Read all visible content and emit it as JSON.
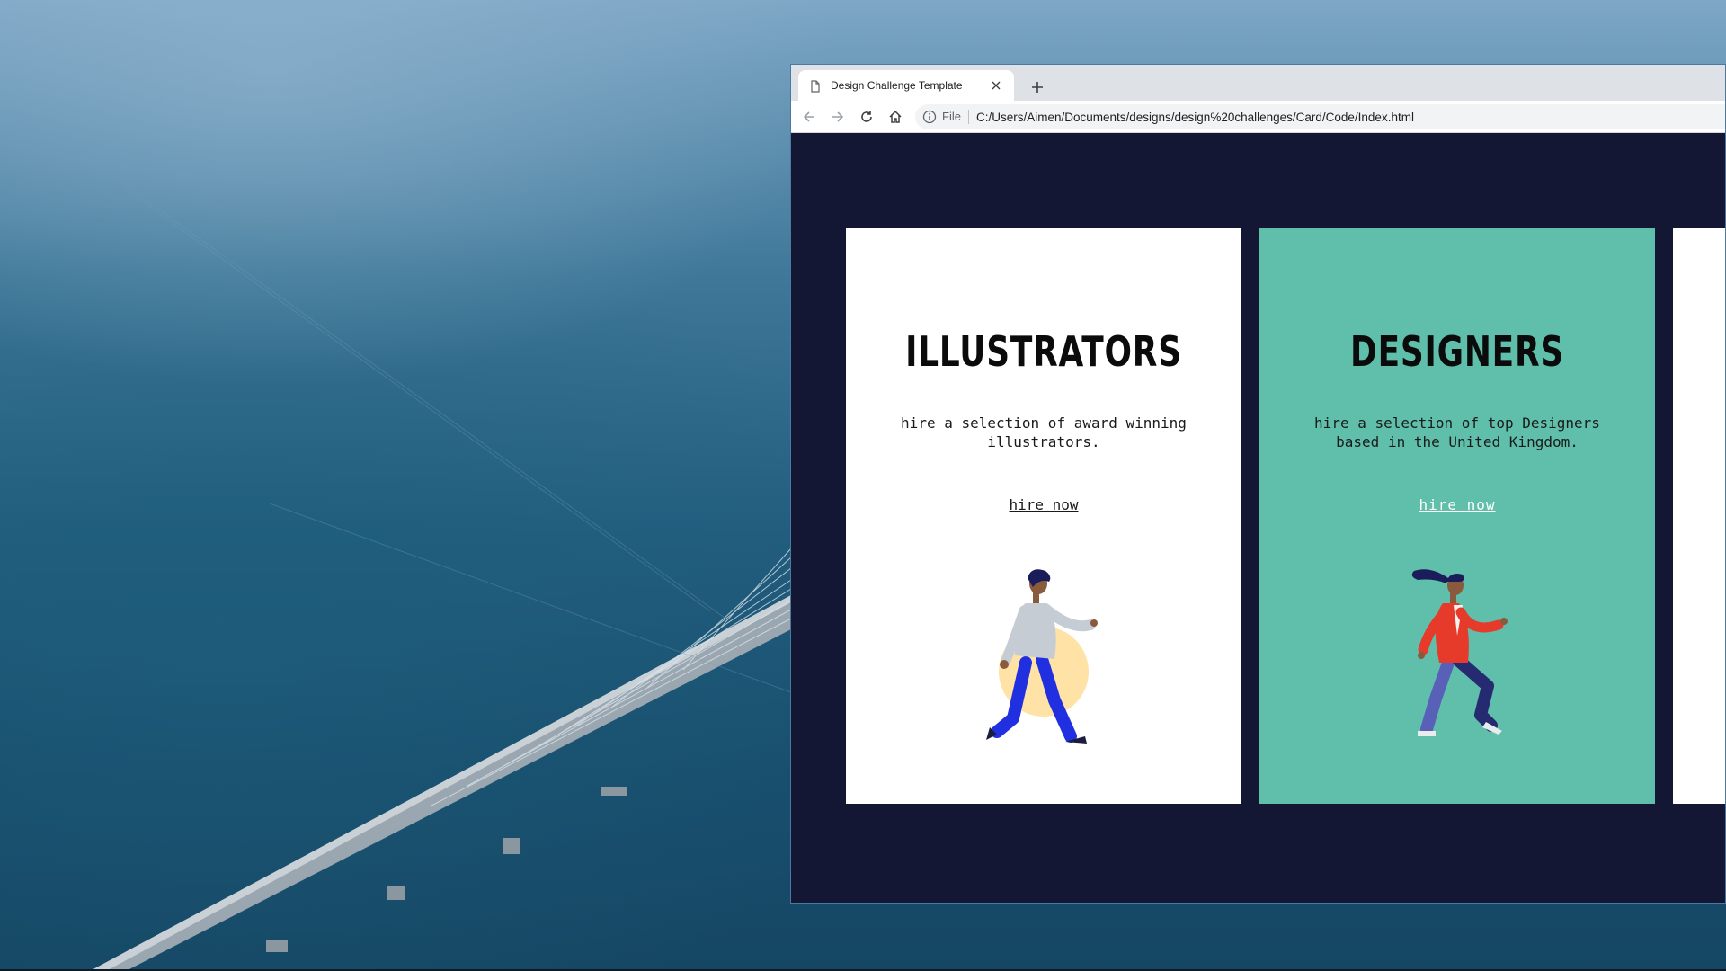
{
  "browser": {
    "tab_title": "Design Challenge Template",
    "address_scheme": "File",
    "address_url": "C:/Users/Aimen/Documents/designs/design%20challenges/Card/Code/Index.html"
  },
  "page": {
    "background_color": "#141734",
    "cards": [
      {
        "title": "ILLUSTRATORS",
        "description": "hire a selection of award winning illustrators.",
        "link": "hire now",
        "background_color": "#ffffff"
      },
      {
        "title": "DESIGNERS",
        "description": "hire a selection of top Designers based in the United Kingdom.",
        "link": "hire now",
        "background_color": "#5fbfab"
      }
    ]
  },
  "icons": [
    "page-icon",
    "close-icon",
    "plus-icon",
    "back-icon",
    "forward-icon",
    "reload-icon",
    "home-icon",
    "info-icon"
  ]
}
